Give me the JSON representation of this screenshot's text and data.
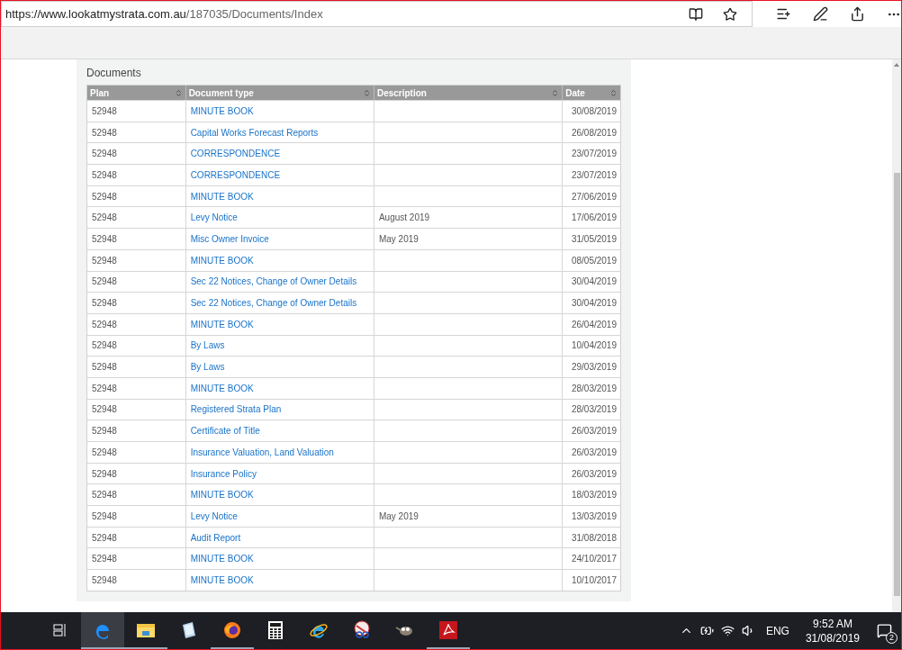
{
  "address_bar": {
    "url_host": "https://www.lookatmystrata.com.au",
    "url_path": "/187035/Documents/Index"
  },
  "panel": {
    "title": "Documents"
  },
  "table": {
    "columns": [
      "Plan",
      "Document type",
      "Description",
      "Date"
    ],
    "rows": [
      {
        "plan": "52948",
        "document_type": "MINUTE BOOK",
        "description": "",
        "date": "30/08/2019"
      },
      {
        "plan": "52948",
        "document_type": "Capital Works Forecast Reports",
        "description": "",
        "date": "26/08/2019"
      },
      {
        "plan": "52948",
        "document_type": "CORRESPONDENCE",
        "description": "",
        "date": "23/07/2019"
      },
      {
        "plan": "52948",
        "document_type": "CORRESPONDENCE",
        "description": "",
        "date": "23/07/2019"
      },
      {
        "plan": "52948",
        "document_type": "MINUTE BOOK",
        "description": "",
        "date": "27/06/2019"
      },
      {
        "plan": "52948",
        "document_type": "Levy Notice",
        "description": "August 2019",
        "date": "17/06/2019"
      },
      {
        "plan": "52948",
        "document_type": "Misc Owner Invoice",
        "description": "May 2019",
        "date": "31/05/2019"
      },
      {
        "plan": "52948",
        "document_type": "MINUTE BOOK",
        "description": "",
        "date": "08/05/2019"
      },
      {
        "plan": "52948",
        "document_type": "Sec 22 Notices, Change of Owner Details",
        "description": "",
        "date": "30/04/2019"
      },
      {
        "plan": "52948",
        "document_type": "Sec 22 Notices, Change of Owner Details",
        "description": "",
        "date": "30/04/2019"
      },
      {
        "plan": "52948",
        "document_type": "MINUTE BOOK",
        "description": "",
        "date": "26/04/2019"
      },
      {
        "plan": "52948",
        "document_type": "By Laws",
        "description": "",
        "date": "10/04/2019"
      },
      {
        "plan": "52948",
        "document_type": "By Laws",
        "description": "",
        "date": "29/03/2019"
      },
      {
        "plan": "52948",
        "document_type": "MINUTE BOOK",
        "description": "",
        "date": "28/03/2019"
      },
      {
        "plan": "52948",
        "document_type": "Registered Strata Plan",
        "description": "",
        "date": "28/03/2019"
      },
      {
        "plan": "52948",
        "document_type": "Certificate of Title",
        "description": "",
        "date": "26/03/2019"
      },
      {
        "plan": "52948",
        "document_type": "Insurance Valuation, Land Valuation",
        "description": "",
        "date": "26/03/2019"
      },
      {
        "plan": "52948",
        "document_type": "Insurance Policy",
        "description": "",
        "date": "26/03/2019"
      },
      {
        "plan": "52948",
        "document_type": "MINUTE BOOK",
        "description": "",
        "date": "18/03/2019"
      },
      {
        "plan": "52948",
        "document_type": "Levy Notice",
        "description": "May 2019",
        "date": "13/03/2019"
      },
      {
        "plan": "52948",
        "document_type": "Audit Report",
        "description": "",
        "date": "31/08/2018"
      },
      {
        "plan": "52948",
        "document_type": "MINUTE BOOK",
        "description": "",
        "date": "24/10/2017"
      },
      {
        "plan": "52948",
        "document_type": "MINUTE BOOK",
        "description": "",
        "date": "10/10/2017"
      }
    ]
  },
  "taskbar": {
    "apps": [
      {
        "kind": "taskview",
        "running": false,
        "selected": false
      },
      {
        "kind": "edge",
        "running": true,
        "selected": true
      },
      {
        "kind": "explorer",
        "running": true,
        "selected": false
      },
      {
        "kind": "notepad",
        "running": false,
        "selected": false
      },
      {
        "kind": "firefox",
        "running": true,
        "selected": false
      },
      {
        "kind": "calculator",
        "running": false,
        "selected": false
      },
      {
        "kind": "ie",
        "running": false,
        "selected": false
      },
      {
        "kind": "snip",
        "running": false,
        "selected": false
      },
      {
        "kind": "gimp",
        "running": false,
        "selected": false
      },
      {
        "kind": "pdf",
        "running": true,
        "selected": false
      }
    ],
    "language": "ENG",
    "time": "9:52 AM",
    "date": "31/08/2019",
    "notifications": "2"
  }
}
